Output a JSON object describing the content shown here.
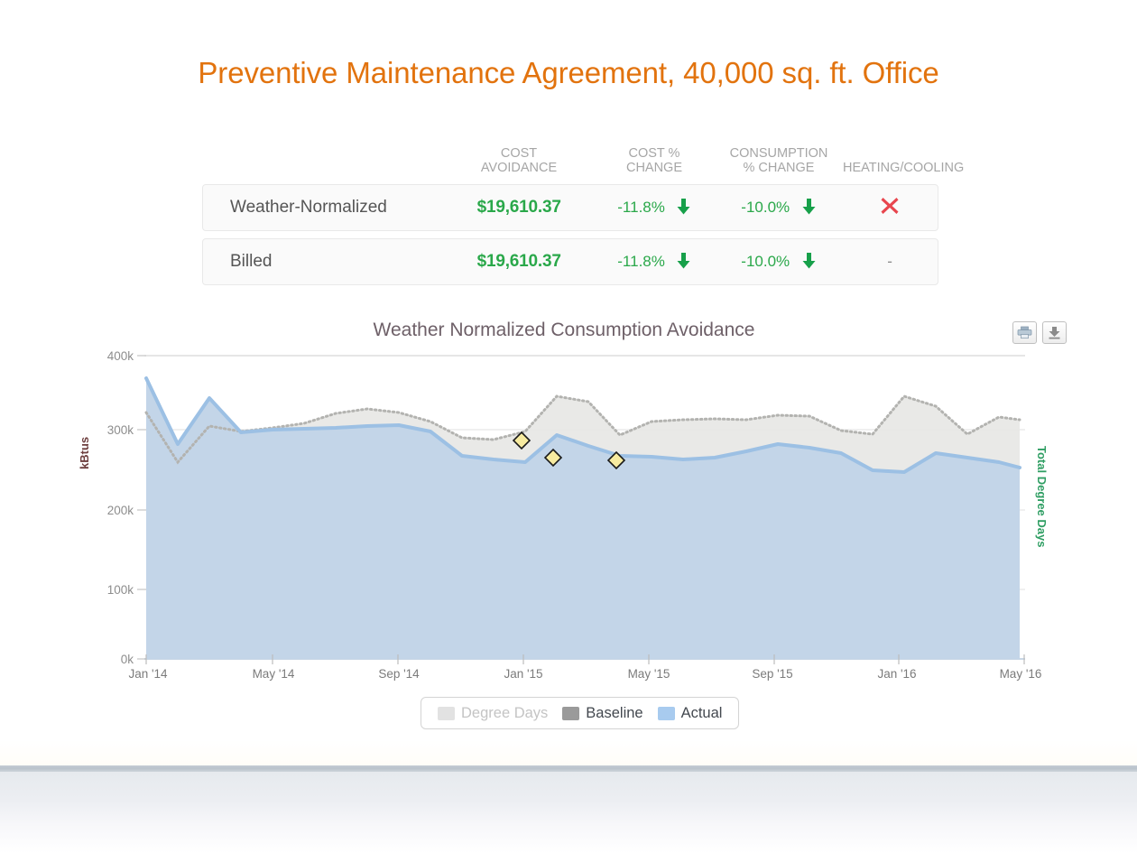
{
  "page": {
    "title": "Preventive Maintenance Agreement, 40,000 sq. ft. Office",
    "title_color": "#e2730e"
  },
  "summary_table": {
    "headers": [
      {
        "label": "",
        "name": "row-label-header"
      },
      {
        "label": "COST\nAVOIDANCE",
        "name": "cost-avoidance-header"
      },
      {
        "label": "COST %\nCHANGE",
        "name": "cost-pct-change-header"
      },
      {
        "label": "CONSUMPTION\n% CHANGE",
        "name": "consumption-pct-change-header"
      },
      {
        "label": "HEATING/COOLING",
        "name": "heating-cooling-header"
      }
    ],
    "rows": [
      {
        "label": "Weather-Normalized",
        "cost_avoidance": "$19,610.37",
        "cost_pct_change": "-11.8%",
        "cost_trend": "arrow-down",
        "consumption_pct_change": "-10.0%",
        "consumption_trend": "arrow-down",
        "heating_cooling": "x-mark"
      },
      {
        "label": "Billed",
        "cost_avoidance": "$19,610.37",
        "cost_pct_change": "-11.8%",
        "cost_trend": "arrow-down",
        "consumption_pct_change": "-10.0%",
        "consumption_trend": "arrow-down",
        "heating_cooling": "-"
      }
    ],
    "colors": {
      "positive_green": "#2aa84a",
      "x_red": "#e8464e",
      "header_grey": "#a6a6a6"
    }
  },
  "chart_toolbar": {
    "print_label": "print-icon",
    "download_label": "download-icon"
  },
  "legend": {
    "items": [
      {
        "label": "Degree Days",
        "color": "#e2e2e2",
        "enabled": false
      },
      {
        "label": "Baseline",
        "color": "#9a9a9a",
        "enabled": true
      },
      {
        "label": "Actual",
        "color": "#a8cbef",
        "enabled": true
      }
    ]
  },
  "chart_data": {
    "type": "area",
    "title": "Weather Normalized Consumption Avoidance",
    "xlabel": "",
    "ylabel": "kBtus",
    "y2label": "Total Degree Days",
    "ylim": [
      0,
      400000
    ],
    "yticks": [
      0,
      100000,
      200000,
      300000,
      400000
    ],
    "ytick_labels": [
      "0k",
      "100k",
      "200k",
      "300k",
      "400k"
    ],
    "grid": true,
    "legend_position": "bottom",
    "xtick_labels": [
      "Jan '14",
      "May '14",
      "Sep '14",
      "Jan '15",
      "May '15",
      "Sep '15",
      "Jan '16",
      "May '16"
    ],
    "xtick_indices": [
      0,
      4,
      8,
      12,
      16,
      20,
      24,
      28
    ],
    "x": [
      "Jan '14",
      "Feb '14",
      "Mar '14",
      "Apr '14",
      "May '14",
      "Jun '14",
      "Jul '14",
      "Aug '14",
      "Sep '14",
      "Oct '14",
      "Nov '14",
      "Dec '14",
      "Jan '15",
      "Feb '15",
      "Mar '15",
      "Apr '15",
      "May '15",
      "Jun '15",
      "Jul '15",
      "Aug '15",
      "Sep '15",
      "Oct '15",
      "Nov '15",
      "Dec '15",
      "Jan '16",
      "Feb '16",
      "Mar '16",
      "Apr '16",
      "May '16"
    ],
    "series": [
      {
        "name": "Actual",
        "color": "#a8cbef",
        "fill": "#c3d5e8",
        "line_color": "#8db4dd",
        "values": [
          355000,
          272000,
          330000,
          287000,
          290000,
          292000,
          293000,
          295000,
          296000,
          289000,
          258000,
          253000,
          250000,
          284000,
          270000,
          258000,
          257000,
          253000,
          256000,
          264000,
          273000,
          268000,
          262000,
          240000,
          238000,
          262000,
          256000,
          250000,
          244000
        ]
      },
      {
        "name": "Baseline",
        "color": "#9a9a9a",
        "fill": "#e8e8e6",
        "line_color": "#b3b3b0",
        "values": [
          312000,
          250000,
          295000,
          288000,
          292000,
          298000,
          310000,
          316000,
          312000,
          300000,
          280000,
          277000,
          288000,
          332000,
          325000,
          283000,
          300000,
          302000,
          303000,
          302000,
          308000,
          307000,
          288000,
          283000,
          330000,
          318000,
          283000,
          305000,
          302000
        ]
      }
    ],
    "markers": [
      {
        "series": "Actual",
        "x": "Jan '15",
        "y": 271000
      },
      {
        "series": "Actual",
        "x": "Feb '15",
        "y": 258000
      },
      {
        "series": "Actual",
        "x": "Apr '15",
        "y": 253000
      }
    ]
  }
}
